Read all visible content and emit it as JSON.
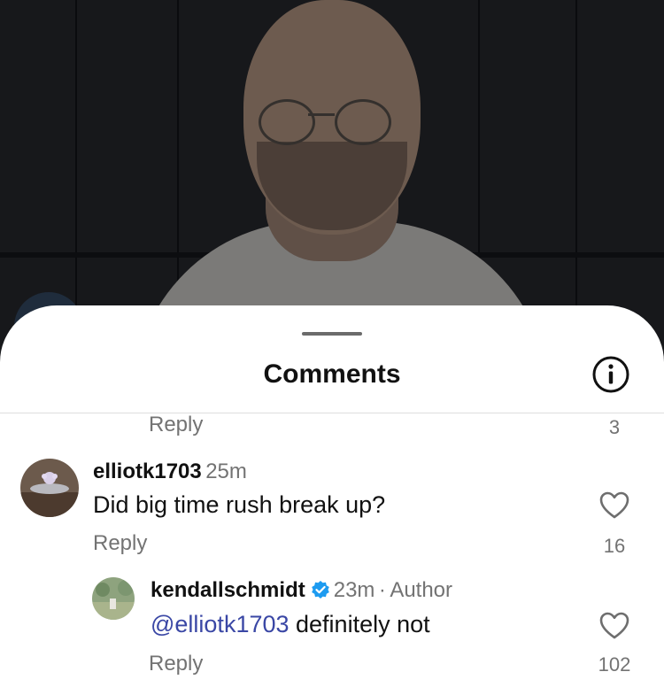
{
  "sheet": {
    "title": "Comments",
    "info_icon": "info-circle-icon"
  },
  "comments": [
    {
      "partial": true,
      "reply_label": "Reply",
      "like_count": "3"
    },
    {
      "username": "elliotk1703",
      "time": "25m",
      "text": "Did big time rush break up?",
      "reply_label": "Reply",
      "like_count": "16"
    },
    {
      "username": "kendallschmidt",
      "verified": true,
      "time": "23m",
      "separator": "·",
      "author_tag": "Author",
      "mention": "@elliotk1703",
      "text": " definitely not",
      "reply_label": "Reply",
      "like_count": "102"
    }
  ],
  "colors": {
    "mention": "#3a47a5",
    "verified": "#1d9bf0",
    "muted": "#737373"
  }
}
